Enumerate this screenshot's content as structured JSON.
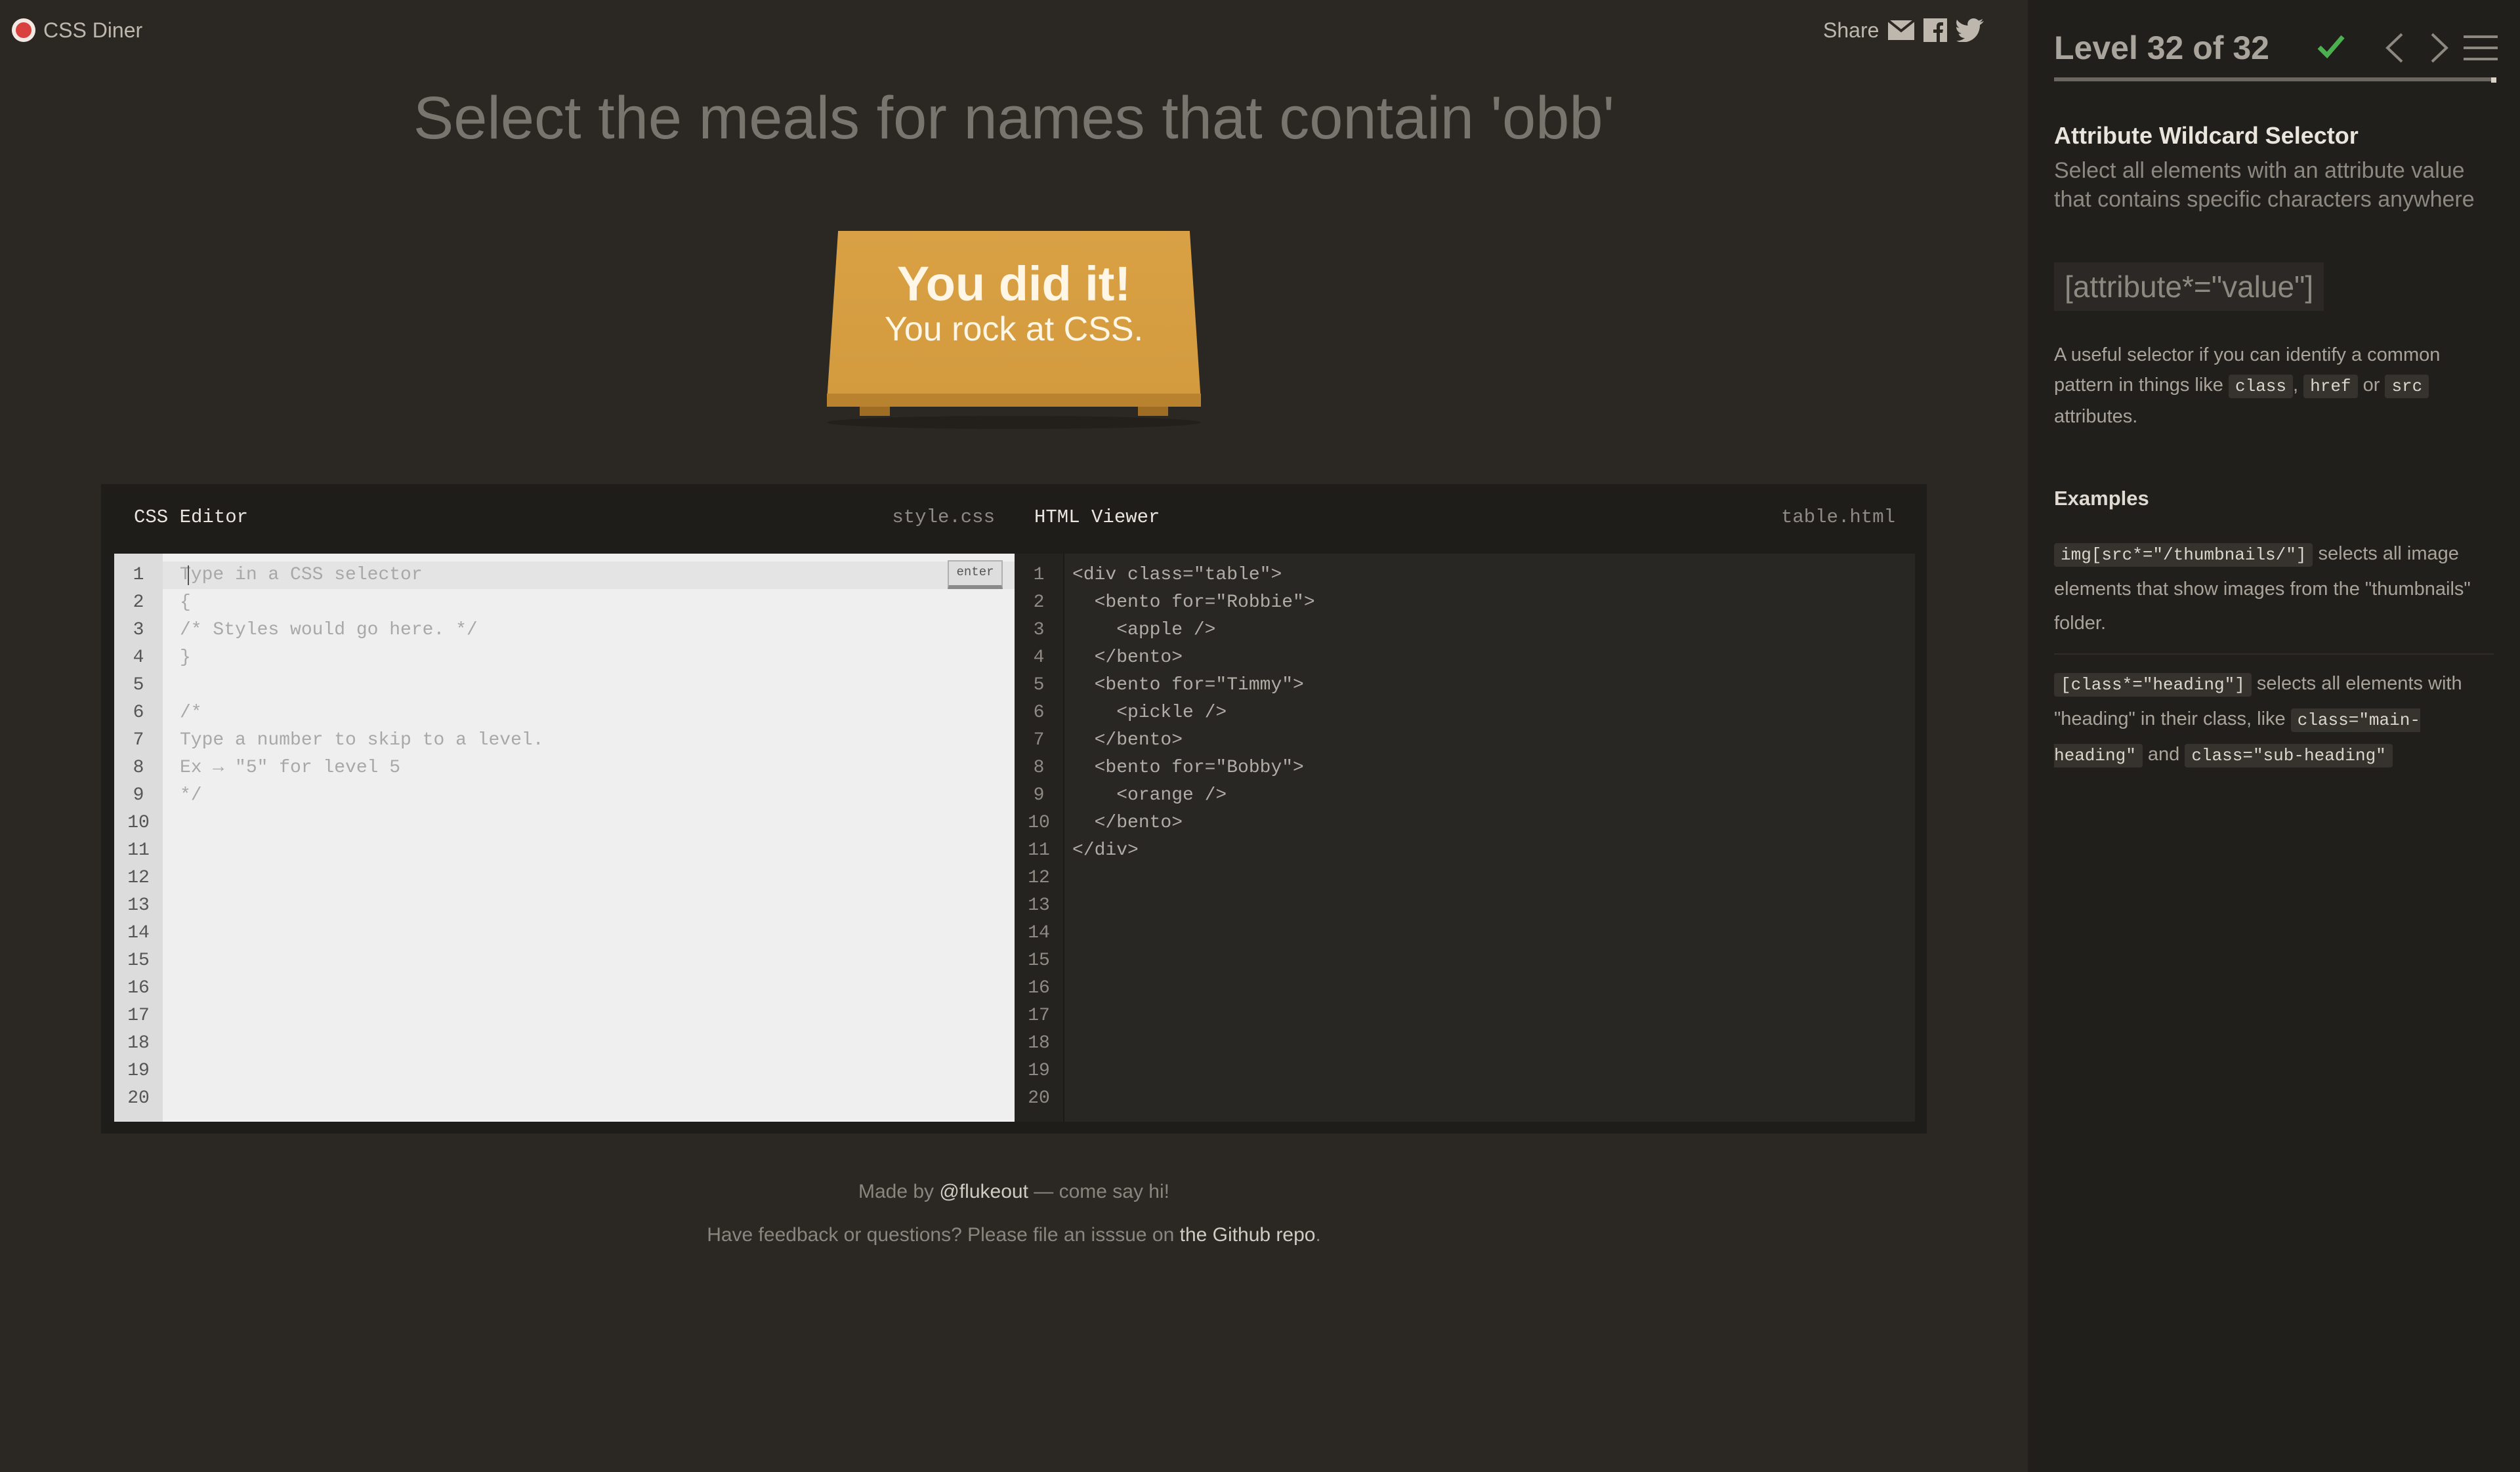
{
  "header": {
    "logo_text": "CSS Diner",
    "share_label": "Share",
    "share_icons": [
      "mail-icon",
      "facebook-icon",
      "twitter-icon"
    ]
  },
  "instruction": "Select the meals for names that contain 'obb'",
  "table": {
    "win_line1": "You did it!",
    "win_line2": "You rock at CSS."
  },
  "css_editor": {
    "title": "CSS Editor",
    "filename": "style.css",
    "input_placeholder": "Type in a CSS selector",
    "enter_label": "enter",
    "line_numbers": [
      "1",
      "2",
      "3",
      "4",
      "5",
      "6",
      "7",
      "8",
      "9",
      "10",
      "11",
      "12",
      "13",
      "14",
      "15",
      "16",
      "17",
      "18",
      "19",
      "20"
    ],
    "lines": [
      "",
      "{",
      "/* Styles would go here. */",
      "}",
      "",
      "/*",
      "Type a number to skip to a level.",
      "Ex → \"5\" for level 5",
      "*/"
    ]
  },
  "html_viewer": {
    "title": "HTML Viewer",
    "filename": "table.html",
    "line_numbers": [
      "1",
      "2",
      "3",
      "4",
      "5",
      "6",
      "7",
      "8",
      "9",
      "10",
      "11",
      "12",
      "13",
      "14",
      "15",
      "16",
      "17",
      "18",
      "19",
      "20"
    ],
    "lines": [
      "<div class=\"table\">",
      "  <bento for=\"Robbie\">",
      "    <apple />",
      "  </bento>",
      "  <bento for=\"Timmy\">",
      "    <pickle />",
      "  </bento>",
      "  <bento for=\"Bobby\">",
      "    <orange />",
      "  </bento>",
      "</div>"
    ]
  },
  "footer": {
    "made_by_prefix": "Made by ",
    "made_by_link": "@flukeout",
    "made_by_suffix": " — come say hi!",
    "feedback_prefix": "Have feedback or questions? Please file an isssue on ",
    "feedback_link": "the Github repo",
    "feedback_suffix": "."
  },
  "sidebar": {
    "level_title": "Level 32 of 32",
    "level_complete": true,
    "progress": 1.0,
    "selector_name": "Attribute Wildcard Selector",
    "selector_description": "Select all elements with an attribute value that contains specific characters anywhere",
    "syntax": "[attribute*=\"value\"]",
    "help_prefix": "A useful selector if you can identify a common pattern in things like ",
    "help_code1": "class",
    "help_sep1": ", ",
    "help_code2": "href",
    "help_sep2": " or ",
    "help_code3": "src",
    "help_suffix": " attributes.",
    "examples_title": "Examples",
    "example1_code": "img[src*=\"/thumbnails/\"]",
    "example1_text": " selects all image elements that show images from the \"thumbnails\" folder.",
    "example2_code": "[class*=\"heading\"]",
    "example2_text1": " selects all elements with \"heading\" in their class, like ",
    "example2_code2": "class=\"main-heading\"",
    "example2_text2": " and ",
    "example2_code3": "class=\"sub-heading\""
  },
  "colors": {
    "background": "#2b2722",
    "sidebar": "#211f1c",
    "table": "#d39a3e",
    "check": "#4caf50"
  }
}
